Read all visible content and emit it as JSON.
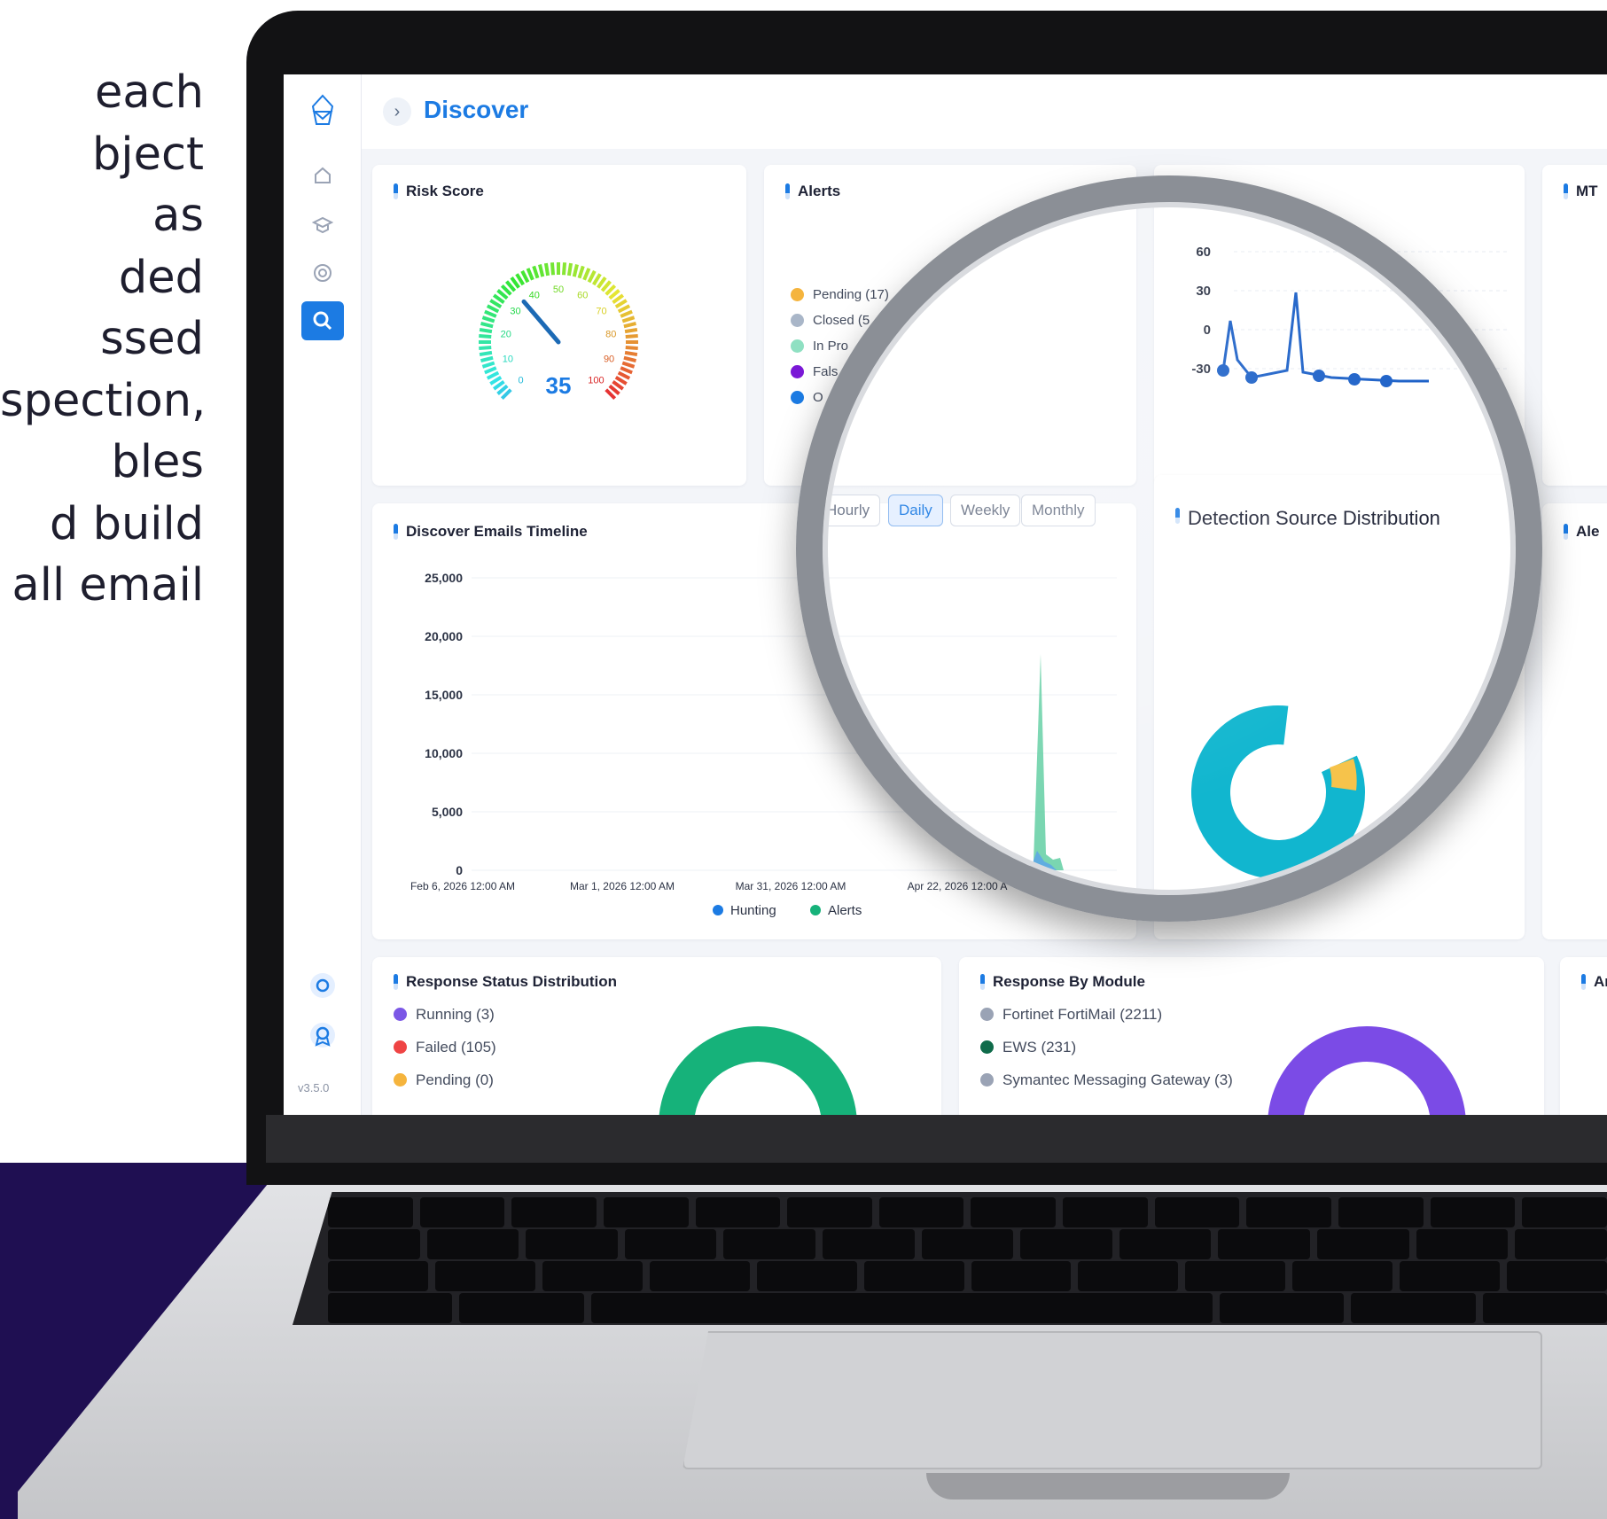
{
  "marketing_copy": {
    "lines": [
      "each",
      "bject",
      "as",
      "ded",
      "ssed",
      "spection,",
      "bles",
      "d build",
      "all email"
    ]
  },
  "app": {
    "page_title": "Discover",
    "version": "v3.5.0",
    "accent_color": "#1c7be3",
    "sidebar_icons": [
      "logo-icon",
      "home-icon",
      "graduation-icon",
      "radar-icon",
      "discover-icon",
      "settings-icon",
      "badge-icon"
    ]
  },
  "risk_score": {
    "title": "Risk Score",
    "value": 35,
    "max": 100,
    "ticks": [
      "0",
      "10",
      "20",
      "30",
      "40",
      "50",
      "60",
      "70",
      "80",
      "90",
      "100"
    ]
  },
  "alerts": {
    "title": "Alerts",
    "legend": [
      {
        "label": "Pending (17)",
        "color": "#f5b43d"
      },
      {
        "label": "Closed (5",
        "color": "#a9b6c8"
      },
      {
        "label": "In Pro",
        "color": "#8fe0c2"
      },
      {
        "label": "Fals",
        "color": "#7a18d6"
      },
      {
        "label": "O",
        "color": "#1c7be3"
      }
    ]
  },
  "mini_line_chart": {
    "y_ticks": [
      "60",
      "30",
      "0",
      "-30"
    ]
  },
  "mtt_card": {
    "title": "MT"
  },
  "timeline": {
    "title": "Discover Emails Timeline",
    "granularity": [
      "Hourly",
      "Daily",
      "Weekly",
      "Monthly"
    ],
    "selected": "Daily",
    "chart_data": {
      "type": "area",
      "y_ticks": [
        "25,000",
        "20,000",
        "15,000",
        "10,000",
        "5,000",
        "0"
      ],
      "ylim": [
        0,
        25000
      ],
      "x_ticks": [
        "Feb 6, 2026 12:00 AM",
        "Mar 1, 2026 12:00 AM",
        "Mar 31, 2026 12:00 AM",
        "Apr 22, 2026 12:00 A"
      ],
      "series": [
        {
          "name": "Hunting",
          "color": "#1c7be3"
        },
        {
          "name": "Alerts",
          "color": "#16b27a"
        }
      ]
    }
  },
  "detection_source": {
    "title": "Detection Source Distribution"
  },
  "alerts_right": {
    "title": "Ale"
  },
  "response_status": {
    "title": "Response Status Distribution",
    "legend": [
      {
        "label": "Running (3)",
        "color": "#7b57e6"
      },
      {
        "label": "Failed (105)",
        "color": "#ef4444"
      },
      {
        "label": "Pending (0)",
        "color": "#f5b43d"
      }
    ]
  },
  "response_module": {
    "title": "Response By Module",
    "legend": [
      {
        "label": "Fortinet FortiMail (2211)",
        "color": "#9aa3b5"
      },
      {
        "label": "EWS (231)",
        "color": "#0f6b4a"
      },
      {
        "label": "Symantec Messaging Gateway (3)",
        "color": "#9aa3b5"
      }
    ]
  },
  "right_bottom": {
    "title": "Ar"
  }
}
